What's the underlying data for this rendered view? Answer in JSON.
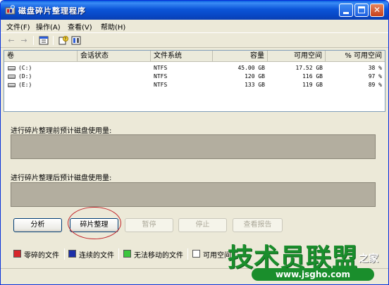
{
  "window": {
    "title": "磁盘碎片整理程序",
    "controls": {
      "minimize": "_",
      "maximize": "□",
      "close": "✕"
    }
  },
  "menu": [
    {
      "label": "文件(F)"
    },
    {
      "label": "操作(A)"
    },
    {
      "label": "查看(V)"
    },
    {
      "label": "帮助(H)"
    }
  ],
  "toolbar": {
    "icons": [
      "back-arrow-icon",
      "forward-arrow-icon",
      "properties-icon",
      "help-icon",
      "view-icon"
    ]
  },
  "volume_list": {
    "columns": [
      "卷",
      "会话状态",
      "文件系统",
      "容量",
      "可用空间",
      "% 可用空间"
    ],
    "rows": [
      {
        "volume": "(C:)",
        "status": "",
        "fs": "NTFS",
        "capacity": "45.00 GB",
        "free": "17.52 GB",
        "pct_free": "38 %"
      },
      {
        "volume": "(D:)",
        "status": "",
        "fs": "NTFS",
        "capacity": "120 GB",
        "free": "116 GB",
        "pct_free": "97 %"
      },
      {
        "volume": "(E:)",
        "status": "",
        "fs": "NTFS",
        "capacity": "133 GB",
        "free": "119 GB",
        "pct_free": "89 %"
      }
    ]
  },
  "panel": {
    "before_label": "进行碎片整理前预计磁盘使用量:",
    "after_label": "进行碎片整理后预计磁盘使用量:"
  },
  "buttons": {
    "analyze": "分析",
    "defragment": "碎片整理",
    "pause": "暂停",
    "stop": "停止",
    "view_report": "查看报告"
  },
  "legend": [
    {
      "label": "零碎的文件",
      "color": "#d7262b"
    },
    {
      "label": "连续的文件",
      "color": "#1c2fa8"
    },
    {
      "label": "无法移动的文件",
      "color": "#3cc63c"
    },
    {
      "label": "可用空间",
      "color": "#ffffff"
    }
  ],
  "watermark": {
    "text": "技术员联盟",
    "suffix": "之家",
    "url": "www.jsgho.com"
  }
}
